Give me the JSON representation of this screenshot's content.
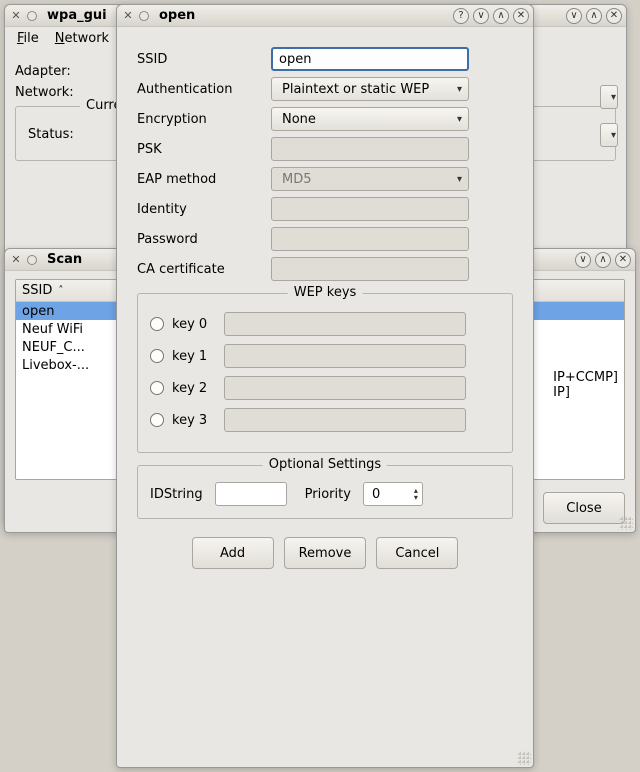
{
  "main": {
    "title": "wpa_gui",
    "menu": {
      "file": "File",
      "network": "Network"
    },
    "adapter_label": "Adapter:",
    "network_label": "Network:",
    "current_status_group": "Current St",
    "status_label": "Status:"
  },
  "scan": {
    "title": "Scan",
    "col_ssid": "SSID",
    "rows": [
      "open",
      "Neuf WiFi",
      "NEUF_C...",
      "Livebox-..."
    ],
    "right_lines": [
      "IP+CCMP]",
      "IP]"
    ],
    "close_label": "Close"
  },
  "open": {
    "title": "open",
    "labels": {
      "ssid": "SSID",
      "auth": "Authentication",
      "enc": "Encryption",
      "psk": "PSK",
      "eap": "EAP method",
      "identity": "Identity",
      "password": "Password",
      "cacert": "CA certificate"
    },
    "fields": {
      "ssid": "open",
      "auth": "Plaintext or static WEP",
      "enc": "None",
      "psk": "",
      "eap": "MD5",
      "identity": "",
      "password": "",
      "cacert": ""
    },
    "wep_group_label": "WEP keys",
    "wep_keys": [
      "key 0",
      "key 1",
      "key 2",
      "key 3"
    ],
    "opt_group_label": "Optional Settings",
    "opt_idstring_label": "IDString",
    "opt_idstring": "",
    "opt_priority_label": "Priority",
    "opt_priority": "0",
    "buttons": {
      "add": "Add",
      "remove": "Remove",
      "cancel": "Cancel"
    }
  }
}
